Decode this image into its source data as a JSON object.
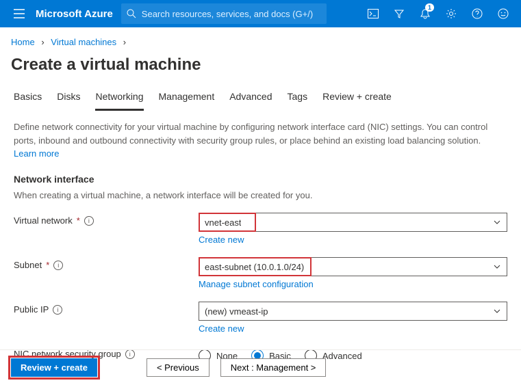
{
  "header": {
    "brand": "Microsoft Azure",
    "search_placeholder": "Search resources, services, and docs (G+/)",
    "notification_count": "1"
  },
  "breadcrumbs": {
    "home": "Home",
    "vm": "Virtual machines"
  },
  "page_title": "Create a virtual machine",
  "tabs": [
    "Basics",
    "Disks",
    "Networking",
    "Management",
    "Advanced",
    "Tags",
    "Review + create"
  ],
  "active_tab_index": 2,
  "description": "Define network connectivity for your virtual machine by configuring network interface card (NIC) settings. You can control ports, inbound and outbound connectivity with security group rules, or place behind an existing load balancing solution.",
  "learn_more": "Learn more",
  "section": {
    "title": "Network interface",
    "subtitle": "When creating a virtual machine, a network interface will be created for you."
  },
  "fields": {
    "vnet": {
      "label": "Virtual network",
      "value": "vnet-east",
      "sublink": "Create new"
    },
    "subnet": {
      "label": "Subnet",
      "value": "east-subnet (10.0.1.0/24)",
      "sublink": "Manage subnet configuration"
    },
    "publicip": {
      "label": "Public IP",
      "value": "(new) vmeast-ip",
      "sublink": "Create new"
    },
    "nsg": {
      "label": "NIC network security group",
      "options": [
        "None",
        "Basic",
        "Advanced"
      ],
      "selected": "Basic"
    }
  },
  "footer": {
    "review": "Review + create",
    "prev": "< Previous",
    "next": "Next : Management >"
  }
}
